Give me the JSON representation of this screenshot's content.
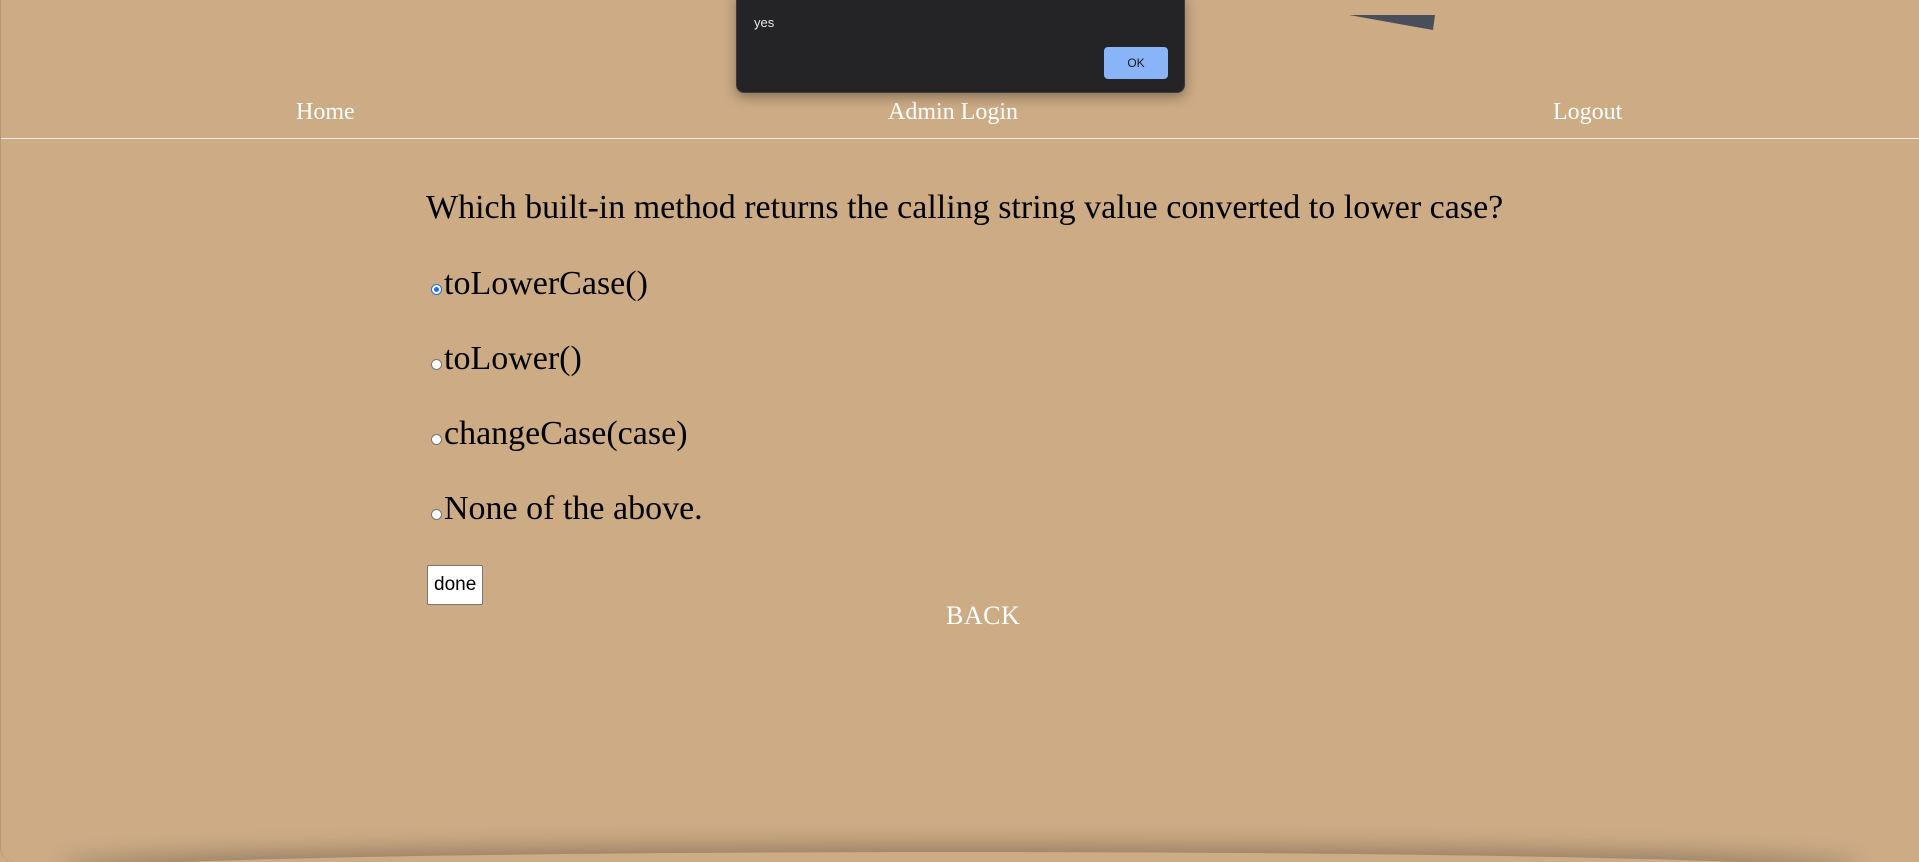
{
  "nav": {
    "home_label": "Home",
    "admin_login_label": "Admin Login",
    "logout_label": "Logout"
  },
  "quiz": {
    "question": "Which built-in method returns the calling string value converted to lower case?",
    "options": [
      {
        "label": "toLowerCase()",
        "selected": true
      },
      {
        "label": "toLower()",
        "selected": false
      },
      {
        "label": "changeCase(case)",
        "selected": false
      },
      {
        "label": "None of the above.",
        "selected": false
      }
    ],
    "done_label": "done",
    "back_label": "BACK"
  },
  "alert": {
    "message": "yes",
    "ok_label": "OK"
  },
  "colors": {
    "background": "#ccab85",
    "alert_background": "#242427",
    "ok_button": "#8ab4f8",
    "radio_selected": "#1a73e8"
  }
}
